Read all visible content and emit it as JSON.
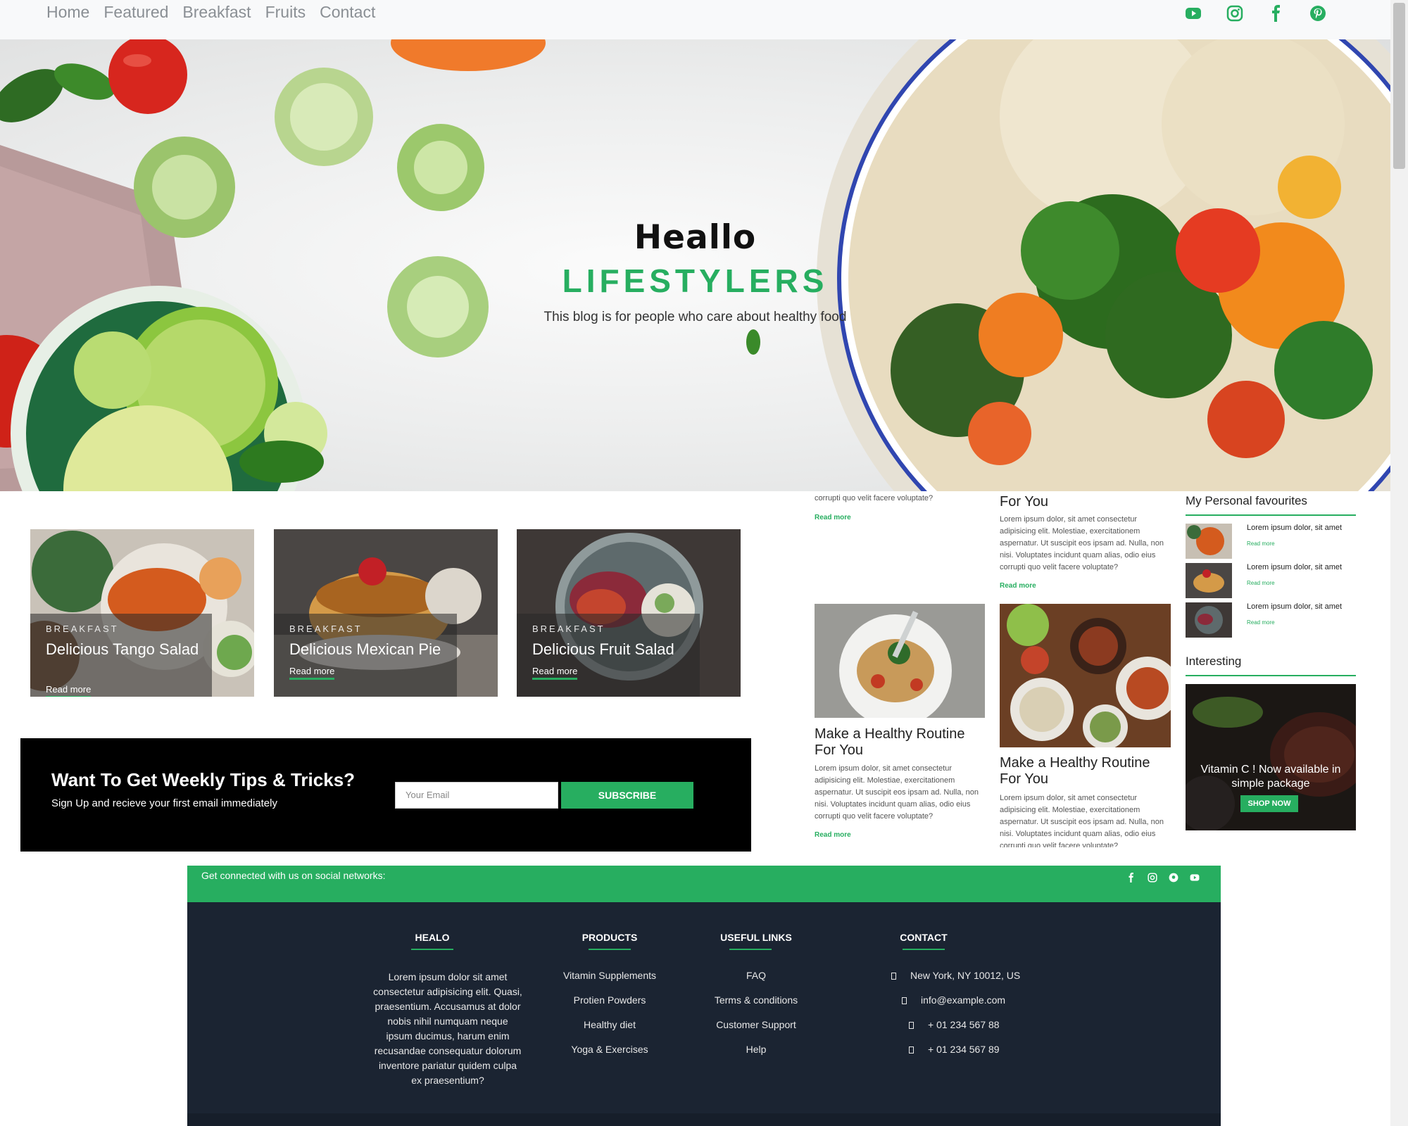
{
  "nav": {
    "links": [
      "Home",
      "Featured",
      "Breakfast",
      "Fruits",
      "Contact"
    ],
    "social_icons": [
      "youtube-icon",
      "instagram-icon",
      "facebook-icon",
      "pinterest-icon"
    ]
  },
  "hero": {
    "title": "Heallo",
    "subtitle": "LIFESTYLERS",
    "tagline": "This blog is for people who care about healthy food"
  },
  "cards": [
    {
      "category": "BREAKFAST",
      "title": "Delicious Tango Salad",
      "link": "Read more"
    },
    {
      "category": "BREAKFAST",
      "title": "Delicious Mexican Pie",
      "link": "Read more"
    },
    {
      "category": "BREAKFAST",
      "title": "Delicious Fruit Salad",
      "link": "Read more"
    }
  ],
  "newsletter": {
    "title": "Want To Get Weekly Tips & Tricks?",
    "subtitle": "Sign Up and recieve your first email immediately",
    "placeholder": "Your Email",
    "button": "SUBSCRIBE"
  },
  "articles": {
    "top_left_text": "corrupti quo velit facere voluptate?",
    "top_left_link": "Read more",
    "top_right_title": "For You",
    "top_right_text": "Lorem ipsum dolor, sit amet consectetur adipisicing elit. Molestiae, exercitationem aspernatur. Ut suscipit eos ipsam ad. Nulla, non nisi. Voluptates incidunt quam alias, odio eius corrupti quo velit facere voluptate?",
    "top_right_link": "Read more",
    "left_title": "Make a Healthy Routine For You",
    "left_text": "Lorem ipsum dolor, sit amet consectetur adipisicing elit. Molestiae, exercitationem aspernatur. Ut suscipit eos ipsam ad. Nulla, non nisi. Voluptates incidunt quam alias, odio eius corrupti quo velit facere voluptate?",
    "left_link": "Read more",
    "right_title": "Make a Healthy Routine For You",
    "right_text": "Lorem ipsum dolor, sit amet consectetur adipisicing elit. Molestiae, exercitationem aspernatur. Ut suscipit eos ipsam ad. Nulla, non nisi. Voluptates incidunt quam alias, odio eius corrupti quo velit facere voluptate?"
  },
  "sidebar": {
    "favourites_heading": "My Personal favourites",
    "favourites": [
      {
        "title": "Lorem ipsum dolor, sit amet",
        "link": "Read more"
      },
      {
        "title": "Lorem ipsum dolor, sit amet",
        "link": "Read more"
      },
      {
        "title": "Lorem ipsum dolor, sit amet",
        "link": "Read more"
      }
    ],
    "interesting_heading": "Interesting",
    "promo_text": "Vitamin C ! Now available in simple package",
    "promo_button": "SHOP NOW"
  },
  "social_bar": {
    "text": "Get connected with us on social networks:",
    "icons": [
      "facebook-icon",
      "instagram-icon",
      "pinterest-icon",
      "youtube-icon"
    ]
  },
  "footer": {
    "col1_heading": "HEALO",
    "col1_text": "Lorem ipsum dolor sit amet consectetur adipisicing elit. Quasi, praesentium. Accusamus at dolor nobis nihil numquam neque ipsum ducimus, harum enim recusandae consequatur dolorum inventore pariatur quidem culpa ex praesentium?",
    "col2_heading": "PRODUCTS",
    "col2_items": [
      "Vitamin Supplements",
      "Protien Powders",
      "Healthy diet",
      "Yoga & Exercises"
    ],
    "col3_heading": "USEFUL LINKS",
    "col3_items": [
      "FAQ",
      "Terms & conditions",
      "Customer Support",
      "Help"
    ],
    "col4_heading": "CONTACT",
    "col4_items": [
      "New York, NY 10012, US",
      "info@example.com",
      "+ 01 234 567 88",
      "+ 01 234 567 89"
    ]
  },
  "colors": {
    "accent": "#27ae60",
    "footer_bg": "#1b2432",
    "newsletter_bg": "#000000"
  }
}
